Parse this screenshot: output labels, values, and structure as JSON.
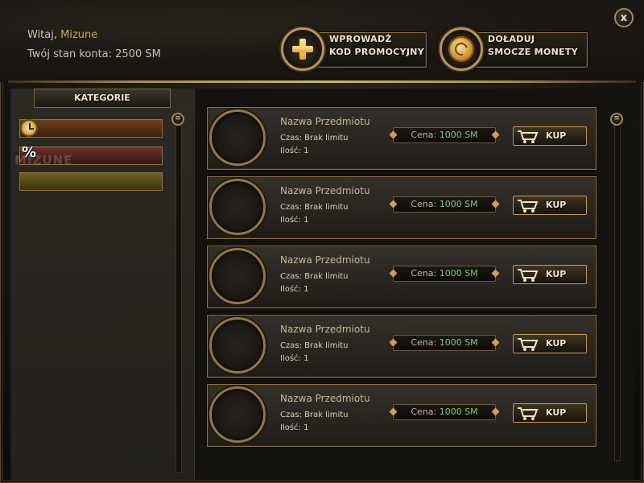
{
  "header": {
    "greeting_prefix": "Witaj,",
    "username": "Mizune",
    "balance_text": "Twój stan konta: 2500 SM",
    "close_label": "x",
    "promo_button": {
      "line1": "WPROWADŹ",
      "line2": "KOD PROMOCYJNY",
      "icon": "plus-icon"
    },
    "coins_button": {
      "line1": "DOŁADUJ",
      "line2": "SMOCZE MONETY",
      "icon": "dragon-coin-icon"
    }
  },
  "sidebar": {
    "title": "KATEGORIE",
    "categories": [
      {
        "icon": "clock-icon",
        "label": ""
      },
      {
        "icon": "percent-icon",
        "label": "%"
      },
      {
        "icon": "",
        "label": ""
      }
    ]
  },
  "items": [
    {
      "name": "Nazwa Przedmiotu",
      "time": "Czas: Brak limitu",
      "qty": "Ilość: 1",
      "price_label": "Cena:",
      "price_value": "1000 SM",
      "buy_label": "KUP"
    },
    {
      "name": "Nazwa Przedmiotu",
      "time": "Czas: Brak limitu",
      "qty": "Ilość: 1",
      "price_label": "Cena:",
      "price_value": "1000 SM",
      "buy_label": "KUP"
    },
    {
      "name": "Nazwa Przedmiotu",
      "time": "Czas: Brak limitu",
      "qty": "Ilość: 1",
      "price_label": "Cena:",
      "price_value": "1000 SM",
      "buy_label": "KUP"
    },
    {
      "name": "Nazwa Przedmiotu",
      "time": "Czas: Brak limitu",
      "qty": "Ilość: 1",
      "price_label": "Cena:",
      "price_value": "1000 SM",
      "buy_label": "KUP"
    },
    {
      "name": "Nazwa Przedmiotu",
      "time": "Czas: Brak limitu",
      "qty": "Ilość: 1",
      "price_label": "Cena:",
      "price_value": "1000 SM",
      "buy_label": "KUP"
    }
  ],
  "watermark": "MIZUNE",
  "colors": {
    "gold": "#c59a48",
    "username": "#d6a447",
    "price_value": "#83c57a"
  }
}
